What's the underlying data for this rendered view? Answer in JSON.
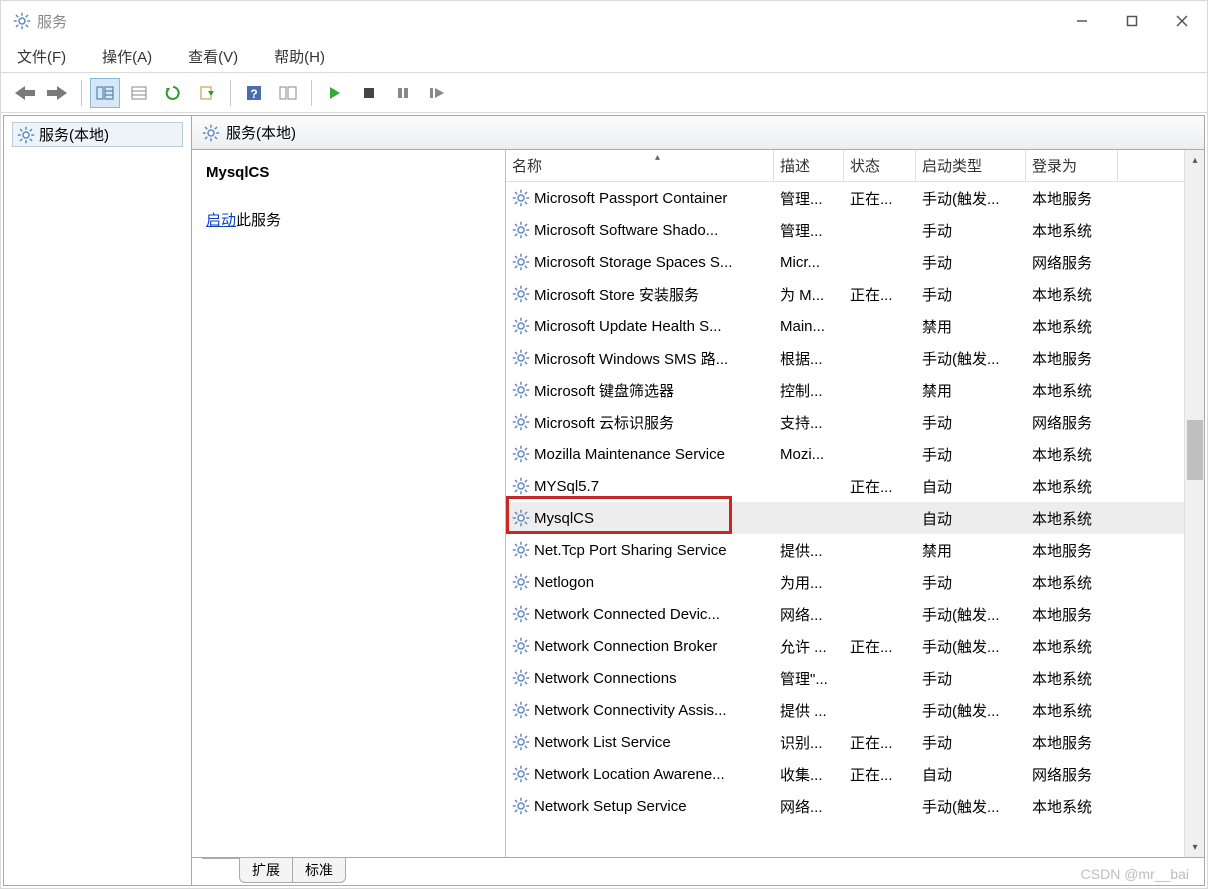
{
  "window": {
    "title": "服务"
  },
  "menu": {
    "file": "文件(F)",
    "action": "操作(A)",
    "view": "查看(V)",
    "help": "帮助(H)"
  },
  "left_tree": {
    "root": "服务(本地)"
  },
  "tab_header": {
    "label": "服务(本地)"
  },
  "detail": {
    "selected_name": "MysqlCS",
    "start_link": "启动",
    "start_suffix": "此服务"
  },
  "columns": {
    "name": "名称",
    "desc": "描述",
    "status": "状态",
    "startup": "启动类型",
    "logon": "登录为"
  },
  "bottom_tabs": {
    "extended": "扩展",
    "standard": "标准"
  },
  "watermark": "CSDN @mr__bai",
  "services": [
    {
      "name": "Microsoft Passport Container",
      "desc": "管理...",
      "status": "正在...",
      "startup": "手动(触发...",
      "logon": "本地服务"
    },
    {
      "name": "Microsoft Software Shado...",
      "desc": "管理...",
      "status": "",
      "startup": "手动",
      "logon": "本地系统"
    },
    {
      "name": "Microsoft Storage Spaces S...",
      "desc": "Micr...",
      "status": "",
      "startup": "手动",
      "logon": "网络服务"
    },
    {
      "name": "Microsoft Store 安装服务",
      "desc": "为 M...",
      "status": "正在...",
      "startup": "手动",
      "logon": "本地系统"
    },
    {
      "name": "Microsoft Update Health S...",
      "desc": "Main...",
      "status": "",
      "startup": "禁用",
      "logon": "本地系统"
    },
    {
      "name": "Microsoft Windows SMS 路...",
      "desc": "根据...",
      "status": "",
      "startup": "手动(触发...",
      "logon": "本地服务"
    },
    {
      "name": "Microsoft 键盘筛选器",
      "desc": "控制...",
      "status": "",
      "startup": "禁用",
      "logon": "本地系统"
    },
    {
      "name": "Microsoft 云标识服务",
      "desc": "支持...",
      "status": "",
      "startup": "手动",
      "logon": "网络服务"
    },
    {
      "name": "Mozilla Maintenance Service",
      "desc": "Mozi...",
      "status": "",
      "startup": "手动",
      "logon": "本地系统"
    },
    {
      "name": "MYSql5.7",
      "desc": "",
      "status": "正在...",
      "startup": "自动",
      "logon": "本地系统"
    },
    {
      "name": "MysqlCS",
      "desc": "",
      "status": "",
      "startup": "自动",
      "logon": "本地系统",
      "selected": true
    },
    {
      "name": "Net.Tcp Port Sharing Service",
      "desc": "提供...",
      "status": "",
      "startup": "禁用",
      "logon": "本地服务"
    },
    {
      "name": "Netlogon",
      "desc": "为用...",
      "status": "",
      "startup": "手动",
      "logon": "本地系统"
    },
    {
      "name": "Network Connected Devic...",
      "desc": "网络...",
      "status": "",
      "startup": "手动(触发...",
      "logon": "本地服务"
    },
    {
      "name": "Network Connection Broker",
      "desc": "允许 ...",
      "status": "正在...",
      "startup": "手动(触发...",
      "logon": "本地系统"
    },
    {
      "name": "Network Connections",
      "desc": "管理\"...",
      "status": "",
      "startup": "手动",
      "logon": "本地系统"
    },
    {
      "name": "Network Connectivity Assis...",
      "desc": "提供 ...",
      "status": "",
      "startup": "手动(触发...",
      "logon": "本地系统"
    },
    {
      "name": "Network List Service",
      "desc": "识别...",
      "status": "正在...",
      "startup": "手动",
      "logon": "本地服务"
    },
    {
      "name": "Network Location Awarene...",
      "desc": "收集...",
      "status": "正在...",
      "startup": "自动",
      "logon": "网络服务"
    },
    {
      "name": "Network Setup Service",
      "desc": "网络...",
      "status": "",
      "startup": "手动(触发...",
      "logon": "本地系统"
    }
  ]
}
